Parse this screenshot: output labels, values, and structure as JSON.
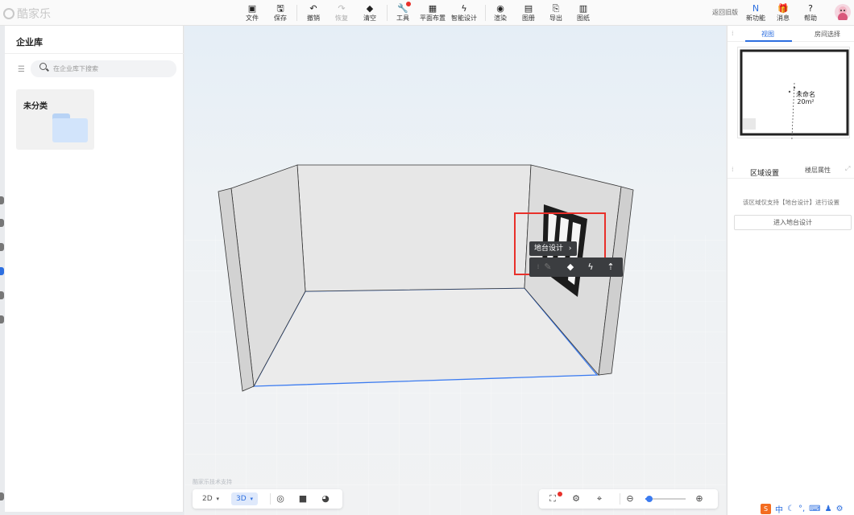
{
  "app": {
    "name": "酷家乐"
  },
  "toolbar": {
    "file": "文件",
    "save": "保存",
    "undo": "撤销",
    "redo": "恢复",
    "clear": "清空",
    "tools": "工具",
    "floor_plan": "平面布置",
    "smart_design": "智能设计",
    "render": "渲染",
    "album": "图册",
    "export": "导出",
    "drawings": "图纸",
    "back_old": "返回旧版",
    "new_features": "新功能",
    "messages": "消息",
    "help": "帮助"
  },
  "left_panel": {
    "title": "企业库",
    "search_placeholder": "在企业库下搜索",
    "folders": [
      {
        "label": "未分类"
      }
    ]
  },
  "viewport": {
    "credit": "酷家乐技术支持",
    "context_label": "地台设计",
    "context_chevron": "›",
    "view_modes": {
      "v2d": "2D",
      "v3d": "3D",
      "caret": "▾"
    },
    "zoom_level": 0.1
  },
  "right_panel": {
    "tabs": {
      "view": "视图",
      "room_select": "房间选择"
    },
    "minimap": {
      "room_name": "未命名",
      "room_area": "20m²"
    },
    "section_tabs": {
      "area_settings": "区域设置",
      "floor_props": "楼层属性"
    },
    "hint": "该区域仅支持【地台设计】进行设置",
    "enter_button": "进入地台设计"
  },
  "ime": {
    "lang": "中"
  },
  "colors": {
    "accent": "#2d6fe0",
    "highlight": "#e8302a",
    "floor_edge": "#3b7bf0"
  }
}
